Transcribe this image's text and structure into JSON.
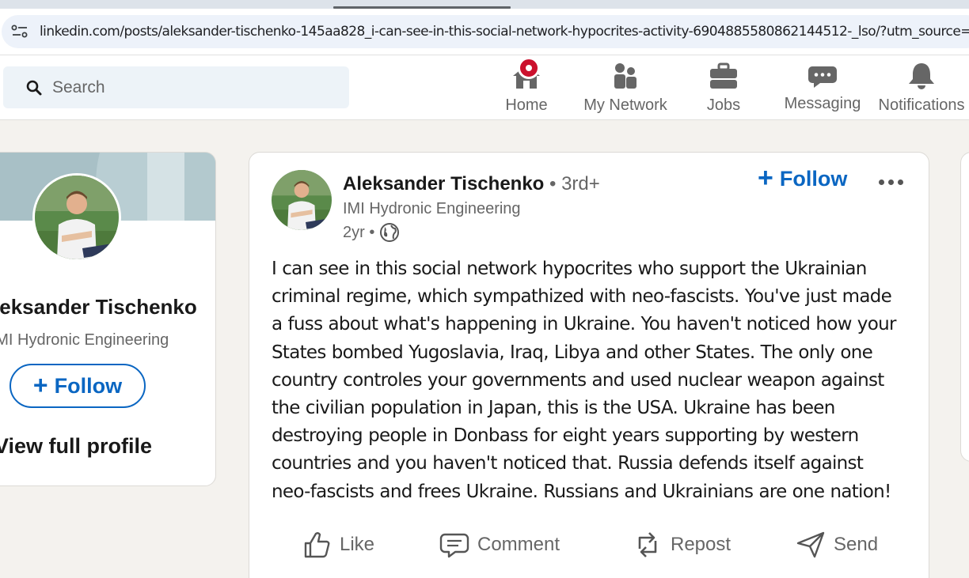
{
  "browser": {
    "url": "linkedin.com/posts/aleksander-tischenko-145aa828_i-can-see-in-this-social-network-hypocrites-activity-6904885580862144512-_lso/?utm_source=share"
  },
  "header": {
    "search_placeholder": "Search",
    "nav": [
      {
        "label": "Home",
        "icon": "home-icon"
      },
      {
        "label": "My Network",
        "icon": "network-icon"
      },
      {
        "label": "Jobs",
        "icon": "briefcase-icon"
      },
      {
        "label": "Messaging",
        "icon": "messaging-icon"
      },
      {
        "label": "Notifications",
        "icon": "bell-icon"
      }
    ]
  },
  "profile_card": {
    "name": "Aleksander Tischenko",
    "company": "IMI Hydronic Engineering",
    "follow_label": "Follow",
    "view_profile_label": "View full profile"
  },
  "post": {
    "author": "Aleksander Tischenko",
    "degree": " • 3rd+",
    "headline": "IMI Hydronic Engineering",
    "time": "2yr •",
    "follow_label": "Follow",
    "text_lines": [
      "I can see in this social network hypocrites who support the Ukrainian",
      "criminal regime, which sympathized with neo-fascists. You've just made",
      "a fuss about what's happening in Ukraine. You haven't noticed how your",
      "States bombed Yugoslavia, Iraq, Libya and other States. The only one",
      "country controles your governments and used nuclear weapon against",
      "the civilian population in Japan, this is the USA. Ukraine has been",
      "destroying people in Donbass for eight years supporting by western",
      "countries and you haven't noticed that. Russia defends itself against",
      "neo-fascists and frees Ukraine. Russians and Ukrainians are one nation!"
    ],
    "actions": [
      {
        "label": "Like",
        "icon": "like-icon"
      },
      {
        "label": "Comment",
        "icon": "comment-icon"
      },
      {
        "label": "Repost",
        "icon": "repost-icon"
      },
      {
        "label": "Send",
        "icon": "send-icon"
      }
    ]
  },
  "colors": {
    "brand_blue": "#0a66c2",
    "notification_badge": "#cb112d",
    "page_bg": "#f4f2ee"
  }
}
